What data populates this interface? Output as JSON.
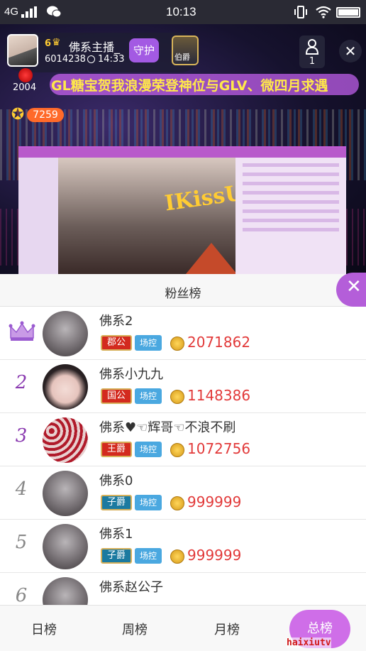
{
  "status_bar": {
    "network": "4G",
    "time": "10:13",
    "icons": [
      "signal-icon",
      "wechat-icon",
      "vibrate-icon",
      "wifi-icon",
      "battery-icon"
    ]
  },
  "live": {
    "host": {
      "level": "6",
      "name": "佛系主播_",
      "id": "6014238",
      "duration": "14:33",
      "guard_label": "守护",
      "rank_badge": "伯爵"
    },
    "viewer_count": "1",
    "gift_count": "2004",
    "marquee": "GL糖宝贺我浪漫荣登神位与GLV、微四月求遇",
    "gold_amount": "7259",
    "screen_text": "IKissU"
  },
  "fan_list": {
    "title": "粉丝榜",
    "entries": [
      {
        "rank": "1",
        "name": "佛系2",
        "title": "郡公",
        "control": "场控",
        "score": "2071862"
      },
      {
        "rank": "2",
        "name": "佛系小九九",
        "title": "国公",
        "control": "场控",
        "score": "1148386"
      },
      {
        "rank": "3",
        "name": "佛系♥☜辉哥☜不浪不刷",
        "title": "王爵",
        "control": "场控",
        "score": "1072756"
      },
      {
        "rank": "4",
        "name": "佛系0",
        "title": "子爵",
        "control": "场控",
        "score": "999999"
      },
      {
        "rank": "5",
        "name": "佛系1",
        "title": "子爵",
        "control": "场控",
        "score": "999999"
      },
      {
        "rank": "6",
        "name": "佛系赵公子",
        "title": "",
        "control": "",
        "score": ""
      }
    ]
  },
  "tabs": {
    "daily": "日榜",
    "weekly": "周榜",
    "monthly": "月榜",
    "total": "总榜"
  },
  "watermark": "haixiutv",
  "colors": {
    "accent": "#b45ed9",
    "score": "#e23a3a",
    "rank2": "#8a3ab0",
    "rank3": "#8a3ab0",
    "rank_other": "#888888"
  }
}
